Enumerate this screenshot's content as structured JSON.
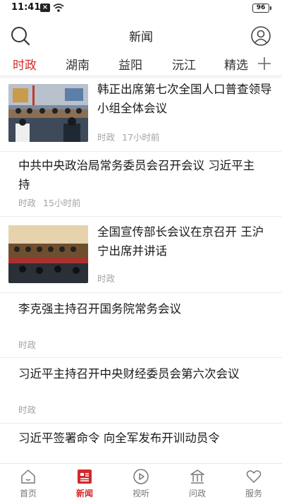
{
  "status": {
    "time": "11:41",
    "battery": "96"
  },
  "header": {
    "title": "新闻"
  },
  "tabs": [
    "时政",
    "湖南",
    "益阳",
    "沅江",
    "精选"
  ],
  "active_tab": 0,
  "news": [
    {
      "title": "韩正出席第七次全国人口普查领导小组全体会议",
      "category": "时政",
      "time": "17小时前",
      "has_image": true
    },
    {
      "title": "中共中央政治局常务委员会召开会议 习近平主持",
      "category": "时政",
      "time": "15小时前",
      "has_image": false
    },
    {
      "title": "全国宣传部长会议在京召开 王沪宁出席并讲话",
      "category": "时政",
      "time": "",
      "has_image": true
    },
    {
      "title": "李克强主持召开国务院常务会议",
      "category": "时政",
      "time": "",
      "has_image": false
    },
    {
      "title": "习近平主持召开中央财经委员会第六次会议",
      "category": "时政",
      "time": "",
      "has_image": false
    },
    {
      "title": "习近平签署命令 向全军发布开训动员令",
      "category": "",
      "time": "",
      "has_image": false
    }
  ],
  "bottom_nav": [
    {
      "label": "首页",
      "icon": "home-icon"
    },
    {
      "label": "新闻",
      "icon": "news-icon"
    },
    {
      "label": "视听",
      "icon": "play-icon"
    },
    {
      "label": "问政",
      "icon": "building-icon"
    },
    {
      "label": "服务",
      "icon": "heart-icon"
    }
  ],
  "active_nav": 1,
  "colors": {
    "accent": "#d22a2a",
    "meta_text": "#a3a3a3"
  }
}
